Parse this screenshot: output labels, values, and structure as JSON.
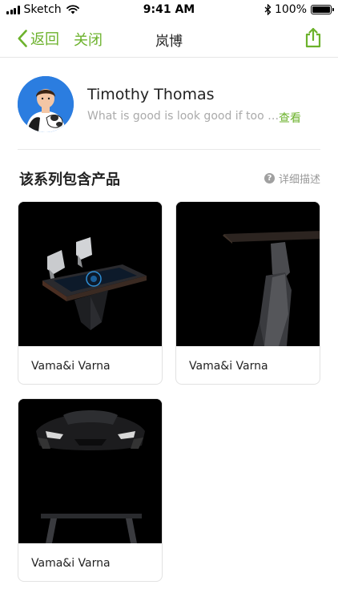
{
  "status": {
    "carrier": "Sketch",
    "time": "9:41 AM",
    "battery_text": "100%",
    "battery_level": 1.0
  },
  "nav": {
    "back_label": "返回",
    "close_label": "关闭",
    "title": "岚博"
  },
  "profile": {
    "name": "Timothy Thomas",
    "description": "What is good is look good if too …",
    "more_label": "查看"
  },
  "section": {
    "title": "该系列包含产品",
    "detail_label": "详细描述",
    "detail_icon": "question-circle-icon"
  },
  "products": [
    {
      "name": "Vama&i Varna"
    },
    {
      "name": "Vama&i Varna"
    },
    {
      "name": "Vama&i Varna"
    }
  ],
  "colors": {
    "accent": "#6cb22c",
    "muted": "#aaaaaa",
    "avatar_bg": "#2b7de0"
  }
}
